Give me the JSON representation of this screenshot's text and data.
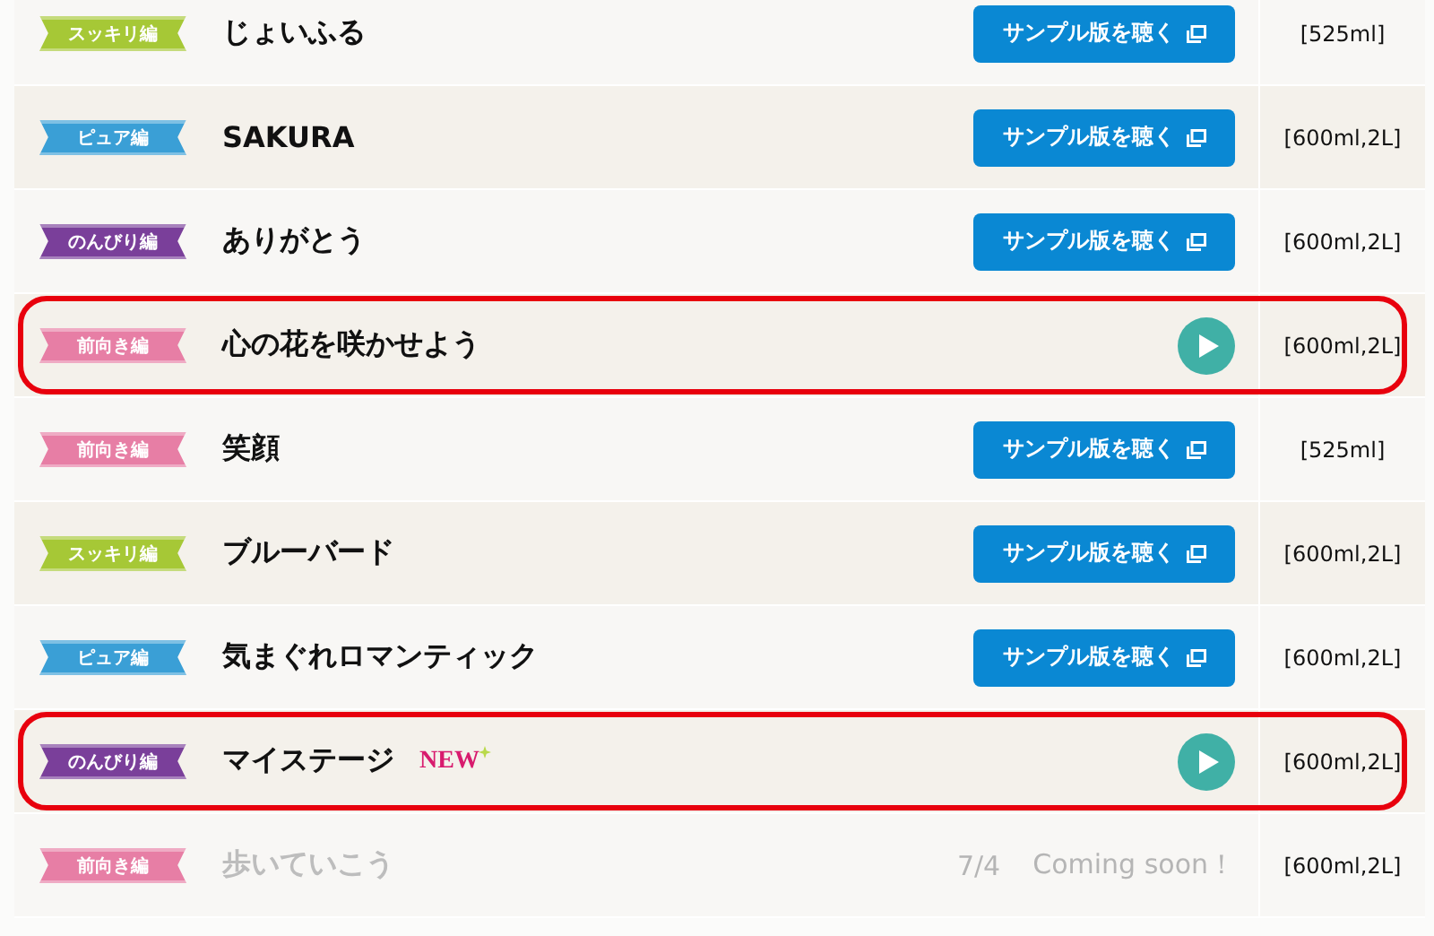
{
  "songs": [
    {
      "genre": "スッキリ編",
      "color": "#a6c836",
      "title": "じょいふる",
      "highlighted": false,
      "action": {
        "kind": "sample",
        "label": "サンプル版を聴く"
      },
      "size": "[525ml]"
    },
    {
      "genre": "ピュア編",
      "color": "#3a9fd6",
      "title": "SAKURA",
      "highlighted": false,
      "action": {
        "kind": "sample",
        "label": "サンプル版を聴く"
      },
      "size": "[600ml,2L]"
    },
    {
      "genre": "のんびり編",
      "color": "#7a3f9a",
      "title": "ありがとう",
      "highlighted": false,
      "action": {
        "kind": "sample",
        "label": "サンプル版を聴く"
      },
      "size": "[600ml,2L]"
    },
    {
      "genre": "前向き編",
      "color": "#e77ea5",
      "title": "心の花を咲かせよう",
      "highlighted": true,
      "action": {
        "kind": "play"
      },
      "size": "[600ml,2L]"
    },
    {
      "genre": "前向き編",
      "color": "#e77ea5",
      "title": "笑顔",
      "highlighted": false,
      "action": {
        "kind": "sample",
        "label": "サンプル版を聴く"
      },
      "size": "[525ml]"
    },
    {
      "genre": "スッキリ編",
      "color": "#a6c836",
      "title": "ブルーバード",
      "highlighted": false,
      "action": {
        "kind": "sample",
        "label": "サンプル版を聴く"
      },
      "size": "[600ml,2L]"
    },
    {
      "genre": "ピュア編",
      "color": "#3a9fd6",
      "title": "気まぐれロマンティック",
      "highlighted": false,
      "action": {
        "kind": "sample",
        "label": "サンプル版を聴く"
      },
      "size": "[600ml,2L]"
    },
    {
      "genre": "のんびり編",
      "color": "#7a3f9a",
      "title": "マイステージ",
      "badge": "NEW",
      "highlighted": true,
      "action": {
        "kind": "play"
      },
      "size": "[600ml,2L]"
    },
    {
      "genre": "前向き編",
      "color": "#e77ea5",
      "title": "歩いていこう",
      "highlighted": false,
      "action": {
        "kind": "coming",
        "date": "7/4",
        "note": "Coming soon！"
      },
      "size": "[600ml,2L]"
    }
  ]
}
